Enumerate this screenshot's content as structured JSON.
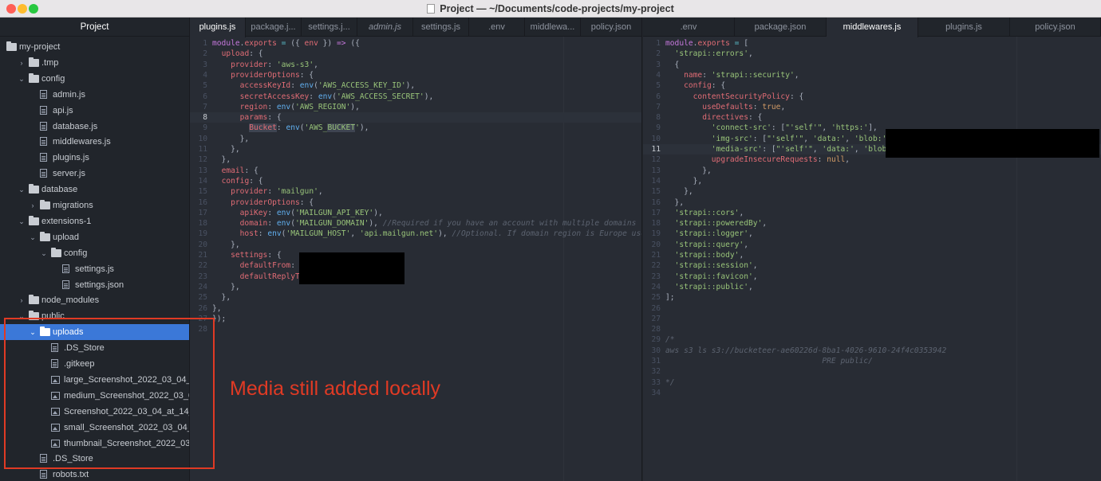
{
  "window": {
    "title": "Project — ~/Documents/code-projects/my-project"
  },
  "sidebar": {
    "header": "Project",
    "items": [
      {
        "name": "my-project",
        "kind": "folder",
        "depth": 0,
        "chev": ""
      },
      {
        "name": ".tmp",
        "kind": "folder",
        "depth": 1,
        "chev": "›"
      },
      {
        "name": "config",
        "kind": "folder",
        "depth": 1,
        "chev": "⌄"
      },
      {
        "name": "admin.js",
        "kind": "file",
        "depth": 2,
        "chev": ""
      },
      {
        "name": "api.js",
        "kind": "file",
        "depth": 2,
        "chev": ""
      },
      {
        "name": "database.js",
        "kind": "file",
        "depth": 2,
        "chev": ""
      },
      {
        "name": "middlewares.js",
        "kind": "file",
        "depth": 2,
        "chev": ""
      },
      {
        "name": "plugins.js",
        "kind": "file",
        "depth": 2,
        "chev": ""
      },
      {
        "name": "server.js",
        "kind": "file",
        "depth": 2,
        "chev": ""
      },
      {
        "name": "database",
        "kind": "folder",
        "depth": 1,
        "chev": "⌄"
      },
      {
        "name": "migrations",
        "kind": "folder",
        "depth": 2,
        "chev": "›"
      },
      {
        "name": "extensions-1",
        "kind": "folder",
        "depth": 1,
        "chev": "⌄"
      },
      {
        "name": "upload",
        "kind": "folder",
        "depth": 2,
        "chev": "⌄"
      },
      {
        "name": "config",
        "kind": "folder",
        "depth": 3,
        "chev": "⌄"
      },
      {
        "name": "settings.js",
        "kind": "file",
        "depth": 4,
        "chev": ""
      },
      {
        "name": "settings.json",
        "kind": "file",
        "depth": 4,
        "chev": ""
      },
      {
        "name": "node_modules",
        "kind": "folder",
        "depth": 1,
        "chev": "›"
      },
      {
        "name": "public",
        "kind": "folder",
        "depth": 1,
        "chev": "⌄"
      },
      {
        "name": "uploads",
        "kind": "folder",
        "depth": 2,
        "chev": "⌄",
        "selected": true
      },
      {
        "name": ".DS_Store",
        "kind": "file",
        "depth": 3,
        "chev": ""
      },
      {
        "name": ".gitkeep",
        "kind": "file",
        "depth": 3,
        "chev": ""
      },
      {
        "name": "large_Screenshot_2022_03_04_at_1",
        "kind": "image",
        "depth": 3,
        "chev": ""
      },
      {
        "name": "medium_Screenshot_2022_03_04_a",
        "kind": "image",
        "depth": 3,
        "chev": ""
      },
      {
        "name": "Screenshot_2022_03_04_at_14_57_",
        "kind": "image",
        "depth": 3,
        "chev": ""
      },
      {
        "name": "small_Screenshot_2022_03_04_at_1",
        "kind": "image",
        "depth": 3,
        "chev": ""
      },
      {
        "name": "thumbnail_Screenshot_2022_03_04",
        "kind": "image",
        "depth": 3,
        "chev": ""
      },
      {
        "name": ".DS_Store",
        "kind": "file",
        "depth": 2,
        "chev": ""
      },
      {
        "name": "robots.txt",
        "kind": "file",
        "depth": 2,
        "chev": ""
      }
    ]
  },
  "left_pane": {
    "tabs": [
      {
        "label": "plugins.js",
        "active": true
      },
      {
        "label": "package.j...",
        "active": false
      },
      {
        "label": "settings.j...",
        "active": false
      },
      {
        "label": "admin.js",
        "active": false,
        "italic": true
      },
      {
        "label": "settings.js",
        "active": false
      },
      {
        "label": ".env",
        "active": false
      },
      {
        "label": "middlewa...",
        "active": false
      },
      {
        "label": "policy.json",
        "active": false
      }
    ],
    "cursor_line": 8,
    "lines": [
      "<span class=\"ct\"><span class=\"k\">module</span>.<span class=\"p\">exports</span> <span class=\"o\">=</span> ({ <span class=\"p\">env</span> }) <span class=\"k\">=&gt;</span> ({</span>",
      "<span class=\"ct\">  <span class=\"p\">upload</span>: {</span>",
      "<span class=\"ct\">    <span class=\"p\">provider</span>: <span class=\"s\">'aws-s3'</span>,</span>",
      "<span class=\"ct\">    <span class=\"p\">providerOptions</span>: {</span>",
      "<span class=\"ct\">      <span class=\"p\">accessKeyId</span>: <span class=\"f\">env</span>(<span class=\"s\">'AWS_ACCESS_KEY_ID'</span>),</span>",
      "<span class=\"ct\">      <span class=\"p\">secretAccessKey</span>: <span class=\"f\">env</span>(<span class=\"s\">'AWS_ACCESS_SECRET'</span>),</span>",
      "<span class=\"ct\">      <span class=\"p\">region</span>: <span class=\"f\">env</span>(<span class=\"s\">'AWS_REGION'</span>),</span>",
      "<span class=\"ct\">      <span class=\"p\">params</span>: {</span>",
      "<span class=\"ct\">        <span class=\"p hl\">Bucket</span>: <span class=\"f\">env</span>(<span class=\"s\">'AWS_<span class=\"hl\">BUCKET</span>'</span>),</span>",
      "<span class=\"ct\">      },</span>",
      "<span class=\"ct\">    },</span>",
      "<span class=\"ct\">  },</span>",
      "<span class=\"ct\">  <span class=\"p\">email</span>: {</span>",
      "<span class=\"ct\">  <span class=\"p\">config</span>: {</span>",
      "<span class=\"ct\">    <span class=\"p\">provider</span>: <span class=\"s\">'mailgun'</span>,</span>",
      "<span class=\"ct\">    <span class=\"p\">providerOptions</span>: {</span>",
      "<span class=\"ct\">      <span class=\"p\">apiKey</span>: <span class=\"f\">env</span>(<span class=\"s\">'MAILGUN_API_KEY'</span>),</span>",
      "<span class=\"ct\">      <span class=\"p\">domain</span>: <span class=\"f\">env</span>(<span class=\"s\">'MAILGUN_DOMAIN'</span>), <span class=\"c\">//Required if you have an account with multiple domains</span></span>",
      "<span class=\"ct\">      <span class=\"p\">host</span>: <span class=\"f\">env</span>(<span class=\"s\">'MAILGUN_HOST'</span>, <span class=\"s\">'api.mailgun.net'</span>), <span class=\"c\">//Optional. If domain region is Europe use 'ap</span></span>",
      "<span class=\"ct\">    },</span>",
      "<span class=\"ct\">    <span class=\"p\">settings</span>: {</span>",
      "<span class=\"ct\">      <span class=\"p\">defaultFrom</span>: <span class=\"s\">'</span></span>",
      "<span class=\"ct\">      <span class=\"p\">defaultReplyTo</span></span>",
      "<span class=\"ct\">    },</span>",
      "<span class=\"ct\">  },</span>",
      "<span class=\"ct\">},</span>",
      "<span class=\"ct\">});</span>",
      "<span class=\"ct\"></span>"
    ]
  },
  "right_pane": {
    "tabs": [
      {
        "label": ".env",
        "active": false
      },
      {
        "label": "package.json",
        "active": false
      },
      {
        "label": "middlewares.js",
        "active": true
      },
      {
        "label": "plugins.js",
        "active": false
      },
      {
        "label": "policy.json",
        "active": false
      }
    ],
    "cursor_line": 11,
    "lines": [
      "<span class=\"ct\"><span class=\"k\">module</span>.<span class=\"p\">exports</span> <span class=\"o\">=</span> [</span>",
      "<span class=\"ct\">  <span class=\"s\">'strapi::errors'</span>,</span>",
      "<span class=\"ct\">  {</span>",
      "<span class=\"ct\">    <span class=\"p\">name</span>: <span class=\"s\">'strapi::security'</span>,</span>",
      "<span class=\"ct\">    <span class=\"p\">config</span>: {</span>",
      "<span class=\"ct\">      <span class=\"p\">contentSecurityPolicy</span>: {</span>",
      "<span class=\"ct\">        <span class=\"p\">useDefaults</span>: <span class=\"n\">true</span>,</span>",
      "<span class=\"ct\">        <span class=\"p\">directives</span>: {</span>",
      "<span class=\"ct\">          <span class=\"s\">'connect-src'</span>: [<span class=\"s\">\"'self'\"</span>, <span class=\"s\">'https:'</span>],</span>",
      "<span class=\"ct\">          <span class=\"s\">'img-src'</span>: [<span class=\"s\">\"'self'\"</span>, <span class=\"s\">'data:'</span>, <span class=\"s\">'blob:'</span>,</span>",
      "<span class=\"ct\">          <span class=\"s\">'media-src'</span>: [<span class=\"s\">\"'self'\"</span>, <span class=\"s\">'data:'</span>, <span class=\"s\">'blob:'</span></span>",
      "<span class=\"ct\">          <span class=\"p\">upgradeInsecureRequests</span>: <span class=\"n\">null</span>,</span>",
      "<span class=\"ct\">        },</span>",
      "<span class=\"ct\">      },</span>",
      "<span class=\"ct\">    },</span>",
      "<span class=\"ct\">  },</span>",
      "<span class=\"ct\">  <span class=\"s\">'strapi::cors'</span>,</span>",
      "<span class=\"ct\">  <span class=\"s\">'strapi::poweredBy'</span>,</span>",
      "<span class=\"ct\">  <span class=\"s\">'strapi::logger'</span>,</span>",
      "<span class=\"ct\">  <span class=\"s\">'strapi::query'</span>,</span>",
      "<span class=\"ct\">  <span class=\"s\">'strapi::body'</span>,</span>",
      "<span class=\"ct\">  <span class=\"s\">'strapi::session'</span>,</span>",
      "<span class=\"ct\">  <span class=\"s\">'strapi::favicon'</span>,</span>",
      "<span class=\"ct\">  <span class=\"s\">'strapi::public'</span>,</span>",
      "<span class=\"ct\">];</span>",
      "<span class=\"ct\"></span>",
      "<span class=\"ct\"></span>",
      "<span class=\"ct\"></span>",
      "<span class=\"ct\"><span class=\"c\">/*</span></span>",
      "<span class=\"ct\"><span class=\"c\">aws s3 ls s3://bucketeer-ae60226d-8ba1-4026-9610-24f4c0353942</span></span>",
      "<span class=\"ct\"><span class=\"c\">                                  PRE public/</span></span>",
      "<span class=\"ct\"></span>",
      "<span class=\"ct\"><span class=\"c\">*/</span></span>",
      "<span class=\"ct\"></span>"
    ]
  },
  "annotation": {
    "text": "Media still added locally",
    "color": "#e03a24"
  },
  "colors": {
    "selection": "#3b78d8",
    "editor_bg": "#282c34",
    "sidebar_bg": "#21252b"
  }
}
